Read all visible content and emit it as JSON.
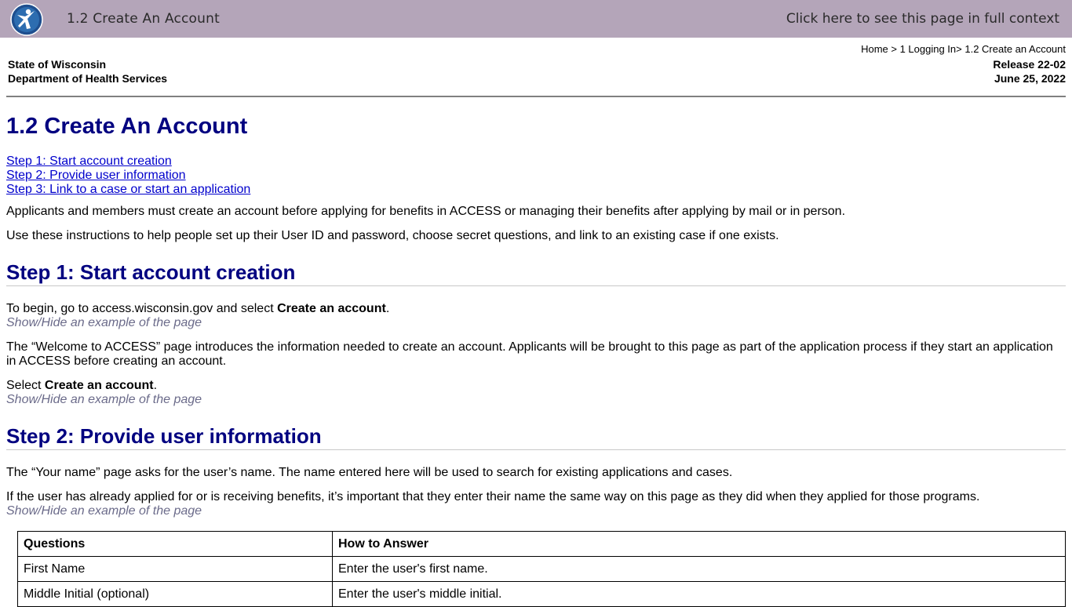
{
  "topbar": {
    "title": "1.2 Create An Account",
    "context_link": "Click here to see this page in full context",
    "logo_icon": "wisconsin-dhs-logo-icon"
  },
  "header": {
    "org_line1": "State of Wisconsin",
    "org_line2": "Department of Health Services",
    "breadcrumb": "Home > 1 Logging In> 1.2 Create an Account",
    "release": "Release 22-02",
    "date": "June 25, 2022"
  },
  "page_title": "1.2 Create An Account",
  "toc": [
    "Step 1: Start account creation ",
    "Step 2: Provide user information ",
    "Step 3: Link to a case or start an application "
  ],
  "intro": [
    "Applicants and members must create an account before applying for benefits in ACCESS or managing their benefits after applying by mail or in person.",
    "Use these instructions to help people set up their User ID and password, choose secret questions, and link to an existing case if one exists."
  ],
  "step1": {
    "heading": "Step 1: Start account creation",
    "p1_pre": "To begin, go to access.wisconsin.gov and select ",
    "p1_bold": "Create an account",
    "p1_post": ".",
    "showhide1": "Show/Hide an example of the page",
    "p2": "The “Welcome to ACCESS” page introduces the information needed to create an account. Applicants will be brought to this page as part of the application process if they start an application in ACCESS before creating an account.",
    "p3_pre": "Select ",
    "p3_bold": "Create an account",
    "p3_post": ".",
    "showhide2": "Show/Hide an example of the page"
  },
  "step2": {
    "heading": "Step 2: Provide user information",
    "p1": "The “Your name” page asks for the user’s name. The name entered here will be used to search for existing applications and cases.",
    "p2": "If the user has already applied for or is receiving benefits, it’s important that they enter their name the same way on this page as they did when they applied for those programs.",
    "showhide": "Show/Hide an example of the page",
    "table": {
      "headers": [
        "Questions",
        "How to Answer"
      ],
      "rows": [
        [
          "First Name",
          "Enter the user's first name."
        ],
        [
          "Middle Initial (optional)",
          "Enter the user's middle initial."
        ]
      ]
    }
  },
  "colors": {
    "topbar_bg": "#b4a5b9",
    "heading": "#000080",
    "link": "#0000cc",
    "showhide": "#6b6b8a"
  }
}
